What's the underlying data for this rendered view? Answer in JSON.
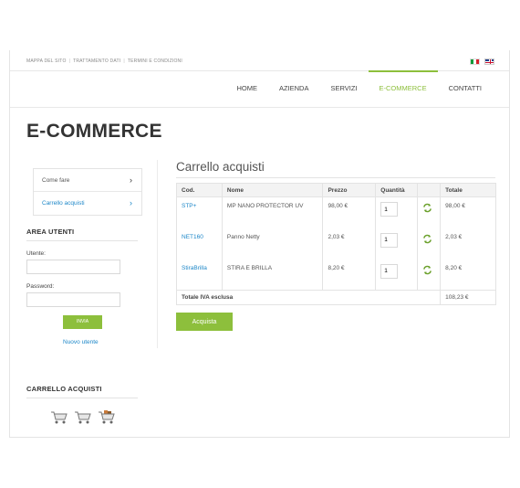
{
  "top_links": [
    "MAPPA DEL SITO",
    "TRATTAMENTO DATI",
    "TERMINI E CONDIZIONI"
  ],
  "top_sep": "|",
  "nav": [
    "HOME",
    "AZIENDA",
    "SERVIZI",
    "E-COMMERCE",
    "CONTATTI"
  ],
  "nav_active": "E-COMMERCE",
  "page_title": "E-COMMERCE",
  "side_menu": [
    {
      "label": "Come fare",
      "active": false
    },
    {
      "label": "Carrello acquisti",
      "active": true
    }
  ],
  "area_utenti": {
    "heading": "AREA UTENTI",
    "user_label": "Utente:",
    "user_value": "",
    "pass_label": "Password:",
    "pass_value": "",
    "submit_label": "INVIA",
    "new_user_label": "Nuovo utente"
  },
  "cart_side": {
    "heading": "CARRELLO ACQUISTI"
  },
  "main": {
    "heading": "Carrello acquisti",
    "columns": [
      "Cod.",
      "Nome",
      "Prezzo",
      "Quantità",
      "",
      "Totale"
    ],
    "rows": [
      {
        "code": "STP+",
        "name": "MP NANO PROTECTOR UV",
        "price": "98,00 €",
        "qty": "1",
        "total": "98,00 €"
      },
      {
        "code": "NET160",
        "name": "Panno Netty",
        "price": "2,03 €",
        "qty": "1",
        "total": "2,03 €"
      },
      {
        "code": "StiraBrilla",
        "name": "STIRA E BRILLA",
        "price": "8,20 €",
        "qty": "1",
        "total": "8,20 €"
      }
    ],
    "total_label": "Totale IVA esclusa",
    "total_value": "108,23 €",
    "buy_label": "Acquista"
  },
  "colors": {
    "accent": "#8dbf3c",
    "link": "#1d87c8"
  }
}
